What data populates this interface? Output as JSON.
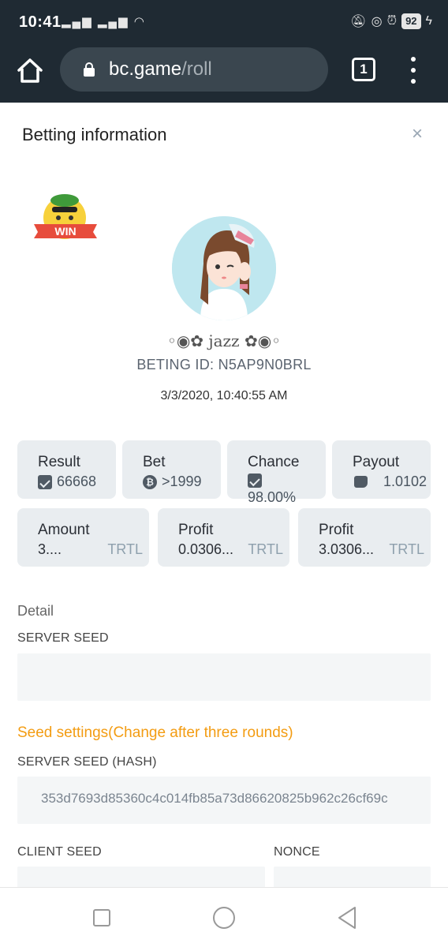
{
  "status": {
    "time": "10:41",
    "battery": "92"
  },
  "browser": {
    "url_host": "bc.game",
    "url_path": "/roll",
    "tab_count": "1"
  },
  "modal": {
    "title": "Betting information",
    "close_label": "×"
  },
  "badge": {
    "text": "WIN"
  },
  "player": {
    "name": "◦◉✿ jazz ✿◉◦",
    "bet_id": "BETING ID: N5AP9N0BRL",
    "time": "3/3/2020, 10:40:55 AM"
  },
  "stats_row1": [
    {
      "label": "Result",
      "value": "66668",
      "icon": "roll-icon"
    },
    {
      "label": "Bet",
      "value": ">1999",
      "icon": "bitcoin-icon"
    },
    {
      "label": "Chance",
      "value": "98.00%",
      "icon": "roll-icon"
    },
    {
      "label": "Payout",
      "value": "1.0102",
      "icon": "payout-icon"
    }
  ],
  "stats_row2": [
    {
      "label": "Amount",
      "value": "3....",
      "unit": "TRTL"
    },
    {
      "label": "Profit",
      "value": "0.0306...",
      "unit": "TRTL"
    },
    {
      "label": "Profit",
      "value": "3.0306...",
      "unit": "TRTL"
    }
  ],
  "detail": {
    "heading": "Detail",
    "server_seed_label": "SERVER SEED",
    "server_seed_value": "",
    "seed_settings_label": "Seed settings(Change after three rounds)",
    "server_seed_hash_label": "SERVER SEED (HASH)",
    "server_seed_hash_value": "353d7693d85360c4c014fb85a73d86620825b962c26cf69c",
    "client_seed_label": "CLIENT SEED",
    "nonce_label": "NONCE"
  },
  "colors": {
    "topbar": "#1f2a33",
    "card_bg": "#e9edf0",
    "accent_orange": "#f39c12",
    "badge_red": "#e74c3c"
  }
}
